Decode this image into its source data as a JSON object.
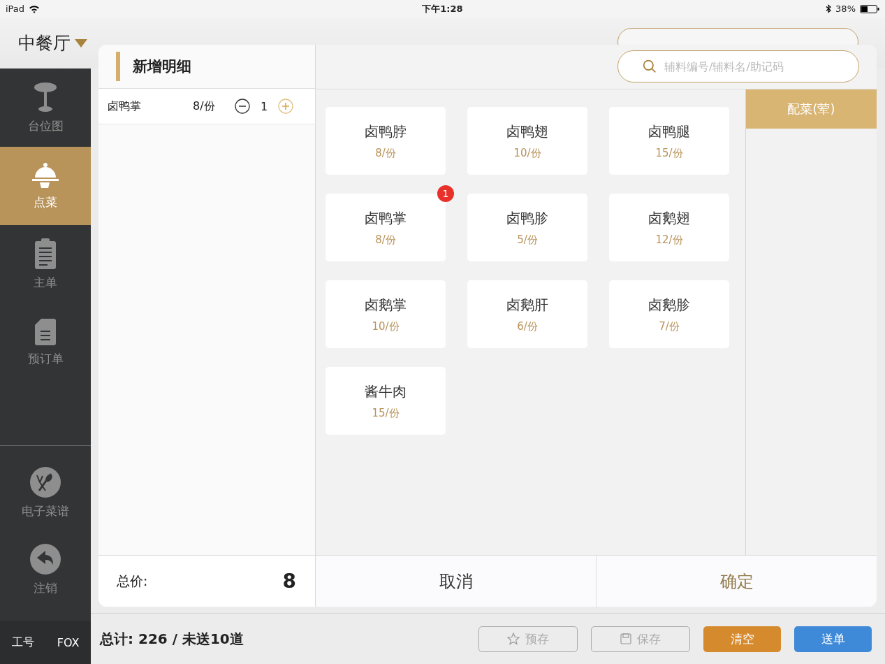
{
  "status_bar": {
    "device": "iPad",
    "time": "下午1:28",
    "battery": "38%"
  },
  "header": {
    "restaurant": "中餐厅"
  },
  "sidebar": {
    "items": [
      {
        "label": "台位图",
        "kind": "table",
        "selected": false
      },
      {
        "label": "点菜",
        "kind": "cloche",
        "selected": true
      },
      {
        "label": "主单",
        "kind": "clipboard",
        "selected": false
      },
      {
        "label": "预订单",
        "kind": "document",
        "selected": false
      }
    ],
    "bottom_items": [
      {
        "label": "电子菜谱",
        "kind": "menu"
      },
      {
        "label": "注销",
        "kind": "logout"
      }
    ],
    "staff_label": "工号",
    "staff_name": "FOX"
  },
  "modal": {
    "title": "新增明细",
    "search": {
      "placeholder": "辅料编号/辅料名/助记码"
    },
    "order_rows": [
      {
        "name": "卤鸭掌",
        "price": "8/份",
        "quantity": "1"
      }
    ],
    "total_label": "总价:",
    "total": "8",
    "dishes": [
      {
        "name": "卤鸭脖",
        "price": "8/份"
      },
      {
        "name": "卤鸭翅",
        "price": "10/份"
      },
      {
        "name": "卤鸭腿",
        "price": "15/份"
      },
      {
        "name": "卤鸭掌",
        "price": "8/份",
        "badge": "1"
      },
      {
        "name": "卤鸭胗",
        "price": "5/份"
      },
      {
        "name": "卤鹅翅",
        "price": "12/份"
      },
      {
        "name": "卤鹅掌",
        "price": "10/份"
      },
      {
        "name": "卤鹅肝",
        "price": "6/份"
      },
      {
        "name": "卤鹅胗",
        "price": "7/份"
      },
      {
        "name": "酱牛肉",
        "price": "15/份"
      }
    ],
    "categories": [
      {
        "label": "配菜(荤)",
        "selected": true
      }
    ],
    "cancel": "取消",
    "confirm": "确定"
  },
  "footer": {
    "summary": "总计: 226 / 未送10道",
    "buttons": [
      {
        "label": "预存",
        "kind": "star"
      },
      {
        "label": "保存",
        "kind": "save"
      },
      {
        "label": "清空",
        "kind": "clear"
      },
      {
        "label": "送单",
        "kind": "send"
      }
    ]
  }
}
